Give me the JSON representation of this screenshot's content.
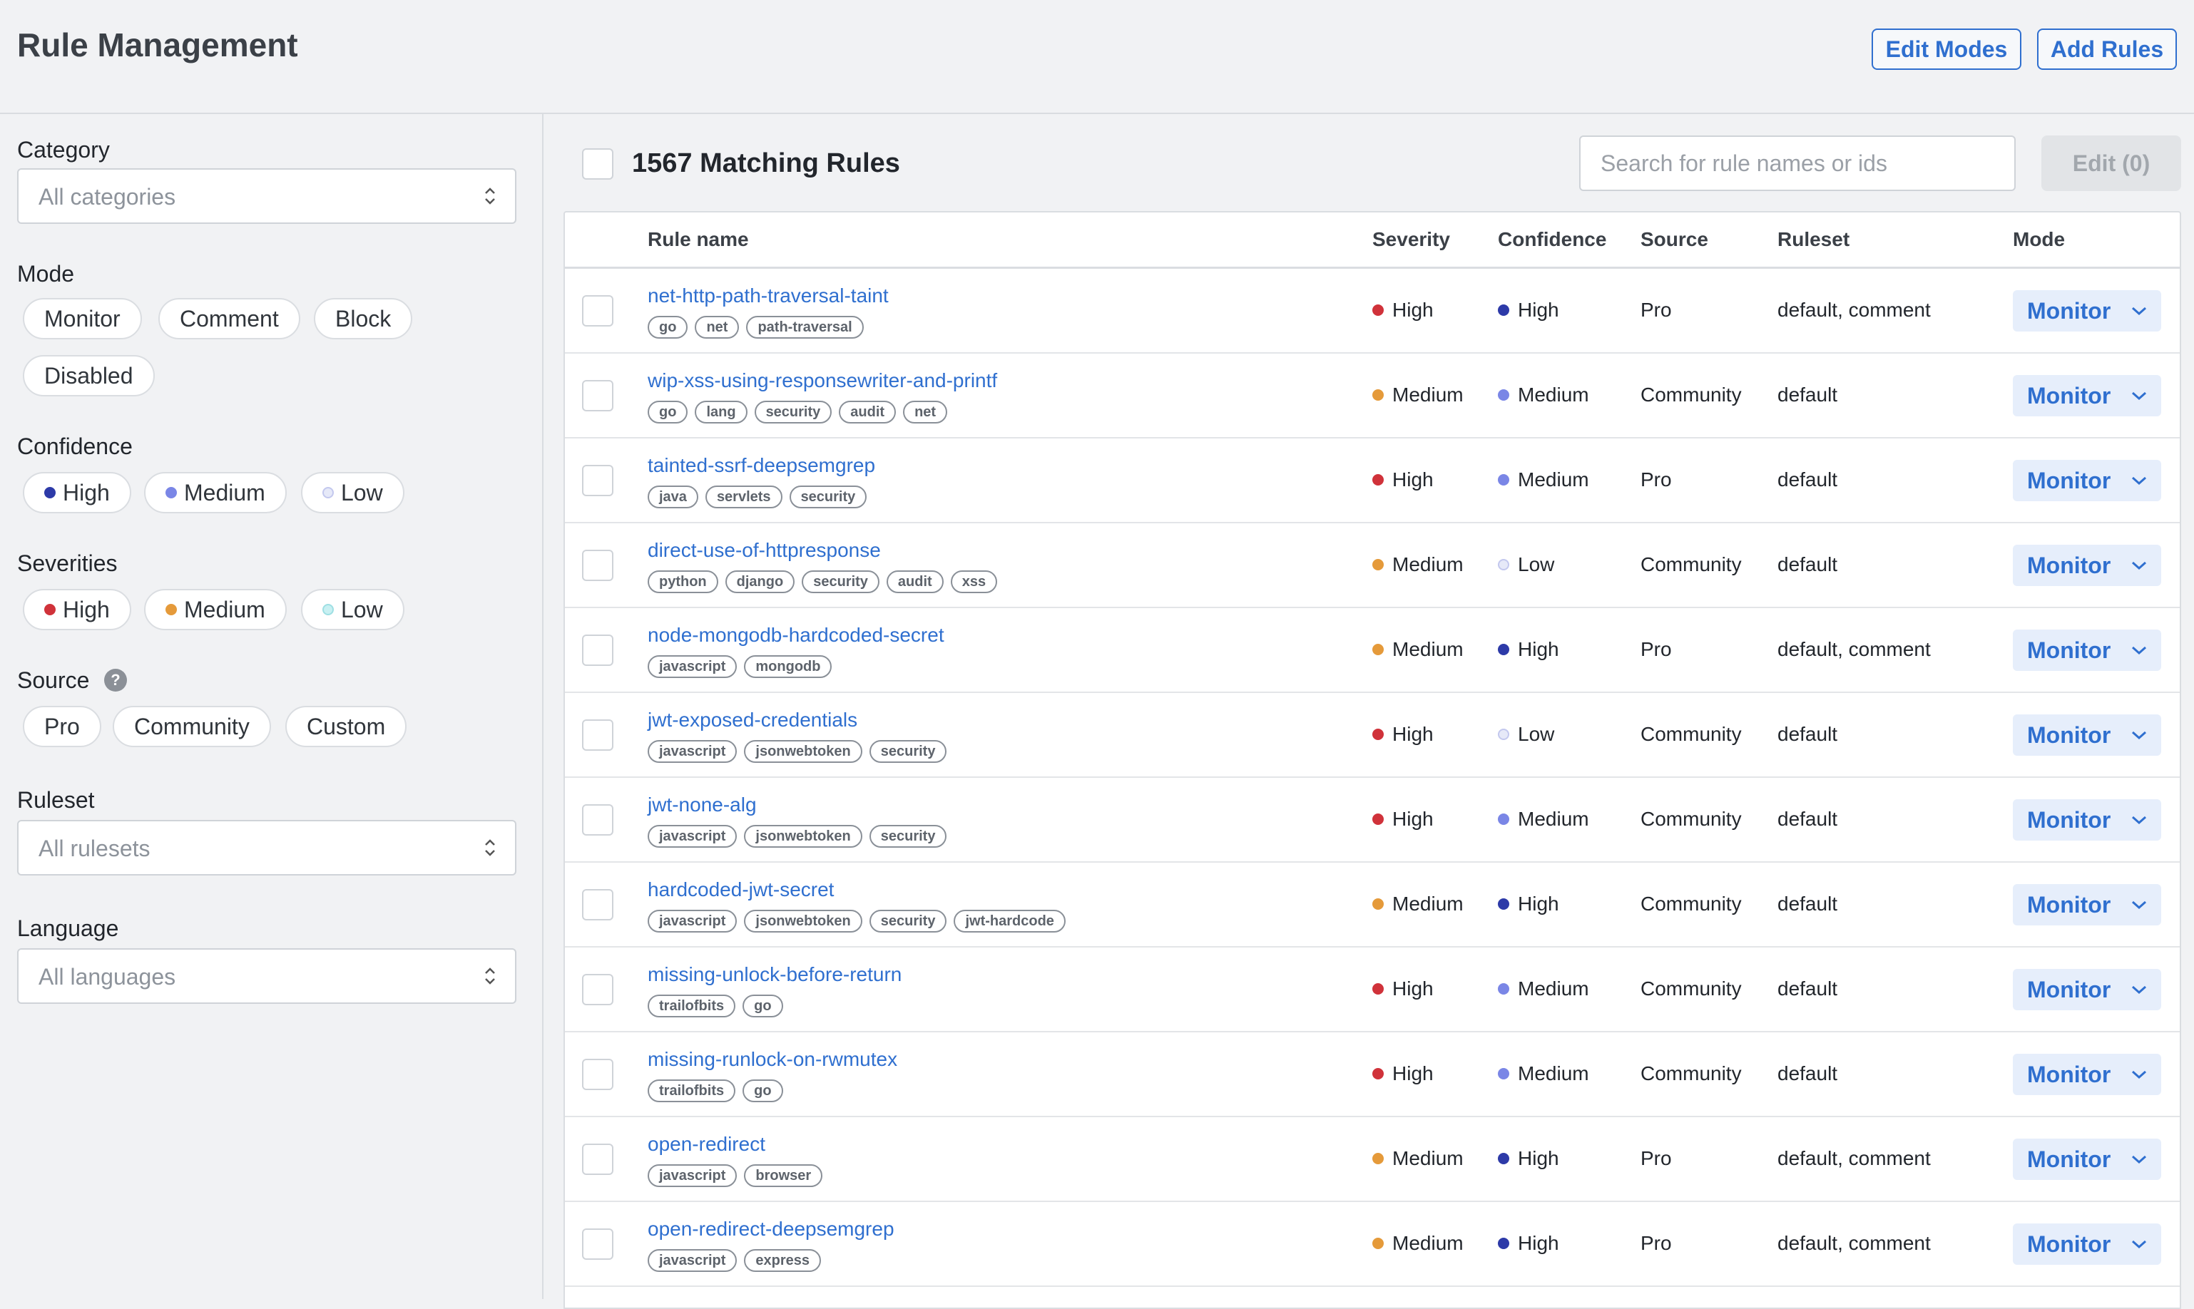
{
  "header": {
    "title": "Rule Management",
    "edit_modes_label": "Edit Modes",
    "add_rules_label": "Add Rules"
  },
  "sidebar": {
    "category": {
      "label": "Category",
      "placeholder": "All categories"
    },
    "mode": {
      "label": "Mode",
      "options": [
        "Monitor",
        "Comment",
        "Block",
        "Disabled"
      ]
    },
    "confidence": {
      "label": "Confidence",
      "options": [
        {
          "label": "High",
          "color": "#2d3aa8"
        },
        {
          "label": "Medium",
          "color": "#7a86e6"
        },
        {
          "label": "Low",
          "color": "#d6daf5"
        }
      ]
    },
    "severities": {
      "label": "Severities",
      "options": [
        {
          "label": "High",
          "color": "#d0323a"
        },
        {
          "label": "Medium",
          "color": "#e59a3a"
        },
        {
          "label": "Low",
          "color": "#b8ecef"
        }
      ]
    },
    "source": {
      "label": "Source",
      "help": "?",
      "options": [
        "Pro",
        "Community",
        "Custom"
      ]
    },
    "ruleset": {
      "label": "Ruleset",
      "placeholder": "All rulesets"
    },
    "language": {
      "label": "Language",
      "placeholder": "All languages"
    }
  },
  "main": {
    "count_title": "1567 Matching Rules",
    "search_placeholder": "Search for rule names or ids",
    "edit_label": "Edit (0)",
    "columns": {
      "rule_name": "Rule name",
      "severity": "Severity",
      "confidence": "Confidence",
      "source": "Source",
      "ruleset": "Ruleset",
      "mode": "Mode"
    },
    "colors": {
      "severity": {
        "High": "#d0323a",
        "Medium": "#e59a3a"
      },
      "confidence": {
        "High": "#2d3aa8",
        "Medium": "#7a86e6",
        "Low": "#d6daf5"
      }
    },
    "rows": [
      {
        "name": "net-http-path-traversal-taint",
        "tags": [
          "go",
          "net",
          "path-traversal"
        ],
        "severity": "High",
        "confidence": "High",
        "source": "Pro",
        "ruleset": "default, comment",
        "mode": "Monitor"
      },
      {
        "name": "wip-xss-using-responsewriter-and-printf",
        "tags": [
          "go",
          "lang",
          "security",
          "audit",
          "net"
        ],
        "severity": "Medium",
        "confidence": "Medium",
        "source": "Community",
        "ruleset": "default",
        "mode": "Monitor"
      },
      {
        "name": "tainted-ssrf-deepsemgrep",
        "tags": [
          "java",
          "servlets",
          "security"
        ],
        "severity": "High",
        "confidence": "Medium",
        "source": "Pro",
        "ruleset": "default",
        "mode": "Monitor"
      },
      {
        "name": "direct-use-of-httpresponse",
        "tags": [
          "python",
          "django",
          "security",
          "audit",
          "xss"
        ],
        "severity": "Medium",
        "confidence": "Low",
        "source": "Community",
        "ruleset": "default",
        "mode": "Monitor"
      },
      {
        "name": "node-mongodb-hardcoded-secret",
        "tags": [
          "javascript",
          "mongodb"
        ],
        "severity": "Medium",
        "confidence": "High",
        "source": "Pro",
        "ruleset": "default, comment",
        "mode": "Monitor"
      },
      {
        "name": "jwt-exposed-credentials",
        "tags": [
          "javascript",
          "jsonwebtoken",
          "security"
        ],
        "severity": "High",
        "confidence": "Low",
        "source": "Community",
        "ruleset": "default",
        "mode": "Monitor"
      },
      {
        "name": "jwt-none-alg",
        "tags": [
          "javascript",
          "jsonwebtoken",
          "security"
        ],
        "severity": "High",
        "confidence": "Medium",
        "source": "Community",
        "ruleset": "default",
        "mode": "Monitor"
      },
      {
        "name": "hardcoded-jwt-secret",
        "tags": [
          "javascript",
          "jsonwebtoken",
          "security",
          "jwt-hardcode"
        ],
        "severity": "Medium",
        "confidence": "High",
        "source": "Community",
        "ruleset": "default",
        "mode": "Monitor"
      },
      {
        "name": "missing-unlock-before-return",
        "tags": [
          "trailofbits",
          "go"
        ],
        "severity": "High",
        "confidence": "Medium",
        "source": "Community",
        "ruleset": "default",
        "mode": "Monitor"
      },
      {
        "name": "missing-runlock-on-rwmutex",
        "tags": [
          "trailofbits",
          "go"
        ],
        "severity": "High",
        "confidence": "Medium",
        "source": "Community",
        "ruleset": "default",
        "mode": "Monitor"
      },
      {
        "name": "open-redirect",
        "tags": [
          "javascript",
          "browser"
        ],
        "severity": "Medium",
        "confidence": "High",
        "source": "Pro",
        "ruleset": "default, comment",
        "mode": "Monitor"
      },
      {
        "name": "open-redirect-deepsemgrep",
        "tags": [
          "javascript",
          "express"
        ],
        "severity": "Medium",
        "confidence": "High",
        "source": "Pro",
        "ruleset": "default, comment",
        "mode": "Monitor"
      }
    ]
  }
}
